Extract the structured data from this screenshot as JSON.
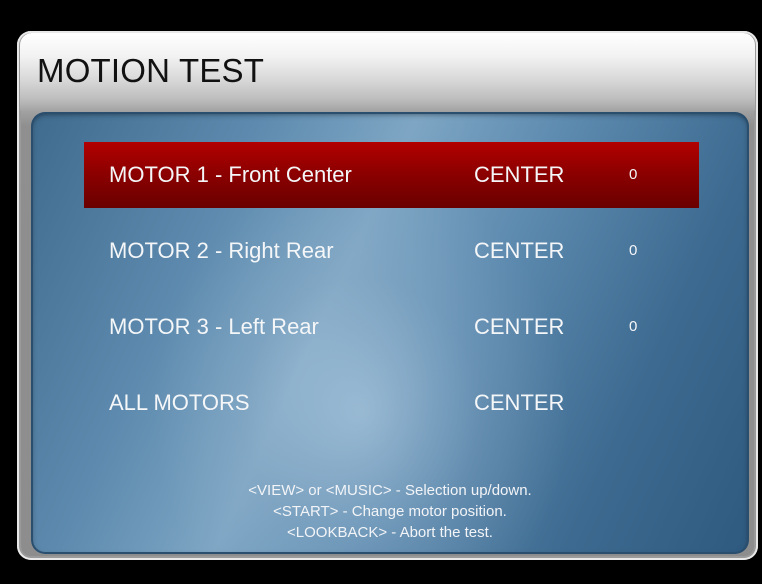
{
  "screen": {
    "title": "MOTION TEST"
  },
  "motors": [
    {
      "label": "MOTOR 1 - Front Center",
      "state": "CENTER",
      "value": "0",
      "selected": true
    },
    {
      "label": "MOTOR 2 - Right Rear",
      "state": "CENTER",
      "value": "0",
      "selected": false
    },
    {
      "label": "MOTOR 3 - Left Rear",
      "state": "CENTER",
      "value": "0",
      "selected": false
    },
    {
      "label": "ALL MOTORS",
      "state": "CENTER",
      "value": "",
      "selected": false
    }
  ],
  "help": {
    "line1": "<VIEW> or <MUSIC> - Selection up/down.",
    "line2": "<START> - Change motor position.",
    "line3": "<LOOKBACK> - Abort the test."
  },
  "colors": {
    "selected_row": "#9a0000",
    "panel_blue": "#5d8aae",
    "text": "#f4f6f8"
  }
}
